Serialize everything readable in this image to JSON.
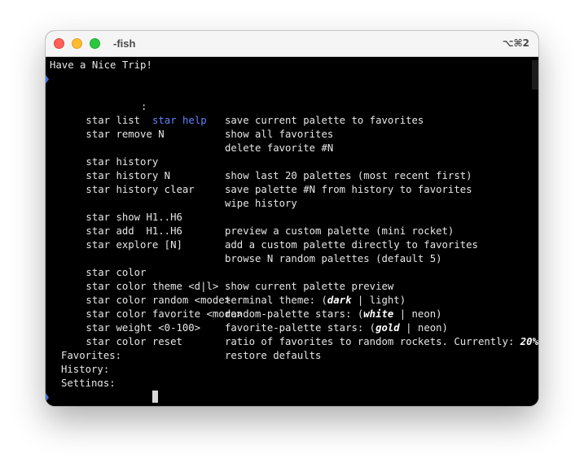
{
  "window": {
    "title": "-fish",
    "shortcut": "⌥⌘2"
  },
  "terminal": {
    "greeting": "Have a Nice Trip!",
    "prompt_separator": ":",
    "command": "star help",
    "help_rows": [
      {
        "cmd": "",
        "desc": "save current palette to favorites"
      },
      {
        "cmd": "star list",
        "desc": "show all favorites"
      },
      {
        "cmd": "star remove N",
        "desc": "delete favorite #N"
      },
      {
        "cmd": "star history",
        "desc": "show last 20 palettes (most recent first)"
      },
      {
        "cmd": "star history N",
        "desc": "save palette #N from history to favorites"
      },
      {
        "cmd": "star history clear",
        "desc": "wipe history"
      },
      {
        "cmd": "star show H1..H6",
        "desc": "preview a custom palette (mini rocket)"
      },
      {
        "cmd": "star add  H1..H6",
        "desc": "add a custom palette directly to favorites"
      },
      {
        "cmd": "star explore [N]",
        "desc": "browse N random palettes (default 5)"
      },
      {
        "cmd": "star color",
        "desc": "show current palette preview"
      },
      {
        "cmd": "star color theme <d|l>",
        "desc_pre": "terminal theme: (",
        "desc_em": "dark",
        "desc_post": " | light)"
      },
      {
        "cmd": "star color random <mode>",
        "desc_pre": "random-palette stars: (",
        "desc_em": "white",
        "desc_post": " | neon)"
      },
      {
        "cmd": "star color favorite <mode>",
        "desc_pre": "favorite-palette stars: (",
        "desc_em": "gold",
        "desc_post": " | neon)"
      },
      {
        "cmd": "star weight <0-100>",
        "desc_pre": "ratio of favorites to random rockets. Currently: ",
        "desc_em": "20%",
        "desc_post": ""
      },
      {
        "cmd": "star color reset",
        "desc": "restore defaults"
      }
    ],
    "sections": {
      "favorites": "Favorites:",
      "history": "History:",
      "settings": "Settings:"
    }
  },
  "colors": {
    "background": "#000000",
    "text": "#e6e6e6",
    "command": "#5c86ff",
    "prompt_marker": "#4a72d8"
  }
}
